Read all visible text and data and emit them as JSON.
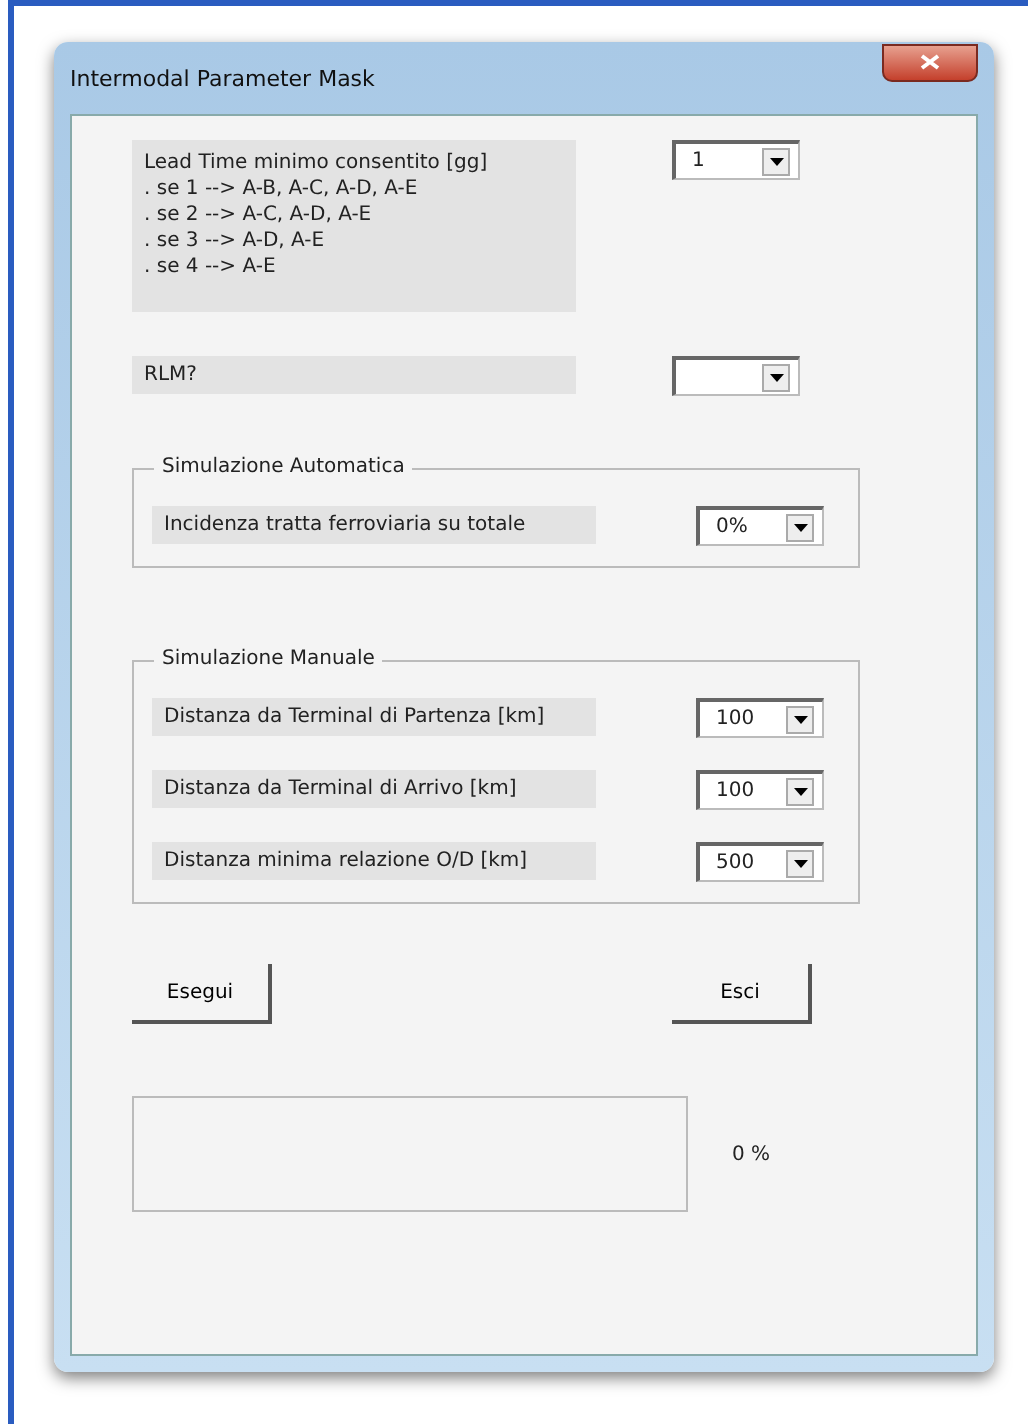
{
  "window": {
    "title": "Intermodal Parameter Mask"
  },
  "lead_time": {
    "lines": [
      "Lead Time minimo consentito [gg]",
      ". se 1 --> A-B, A-C, A-D, A-E",
      ". se 2 --> A-C, A-D, A-E",
      ". se 3 --> A-D, A-E",
      ". se 4 --> A-E"
    ],
    "value": "1"
  },
  "rlm": {
    "label": "RLM?"
  },
  "groups": [
    {
      "title": "Simulazione Automatica",
      "rows": [
        {
          "label": "Incidenza tratta ferroviaria su totale",
          "value": "0%"
        }
      ]
    },
    {
      "title": "Simulazione Manuale",
      "rows": [
        {
          "label": "Distanza da Terminal di Partenza [km]",
          "value": "100"
        },
        {
          "label": "Distanza da Terminal di Arrivo [km]",
          "value": "100"
        },
        {
          "label": "Distanza minima relazione O/D [km]",
          "value": "500"
        }
      ]
    }
  ],
  "buttons": [
    "Esegui",
    "Esci"
  ],
  "progress": {
    "level": 0,
    "reading": "0 %"
  }
}
